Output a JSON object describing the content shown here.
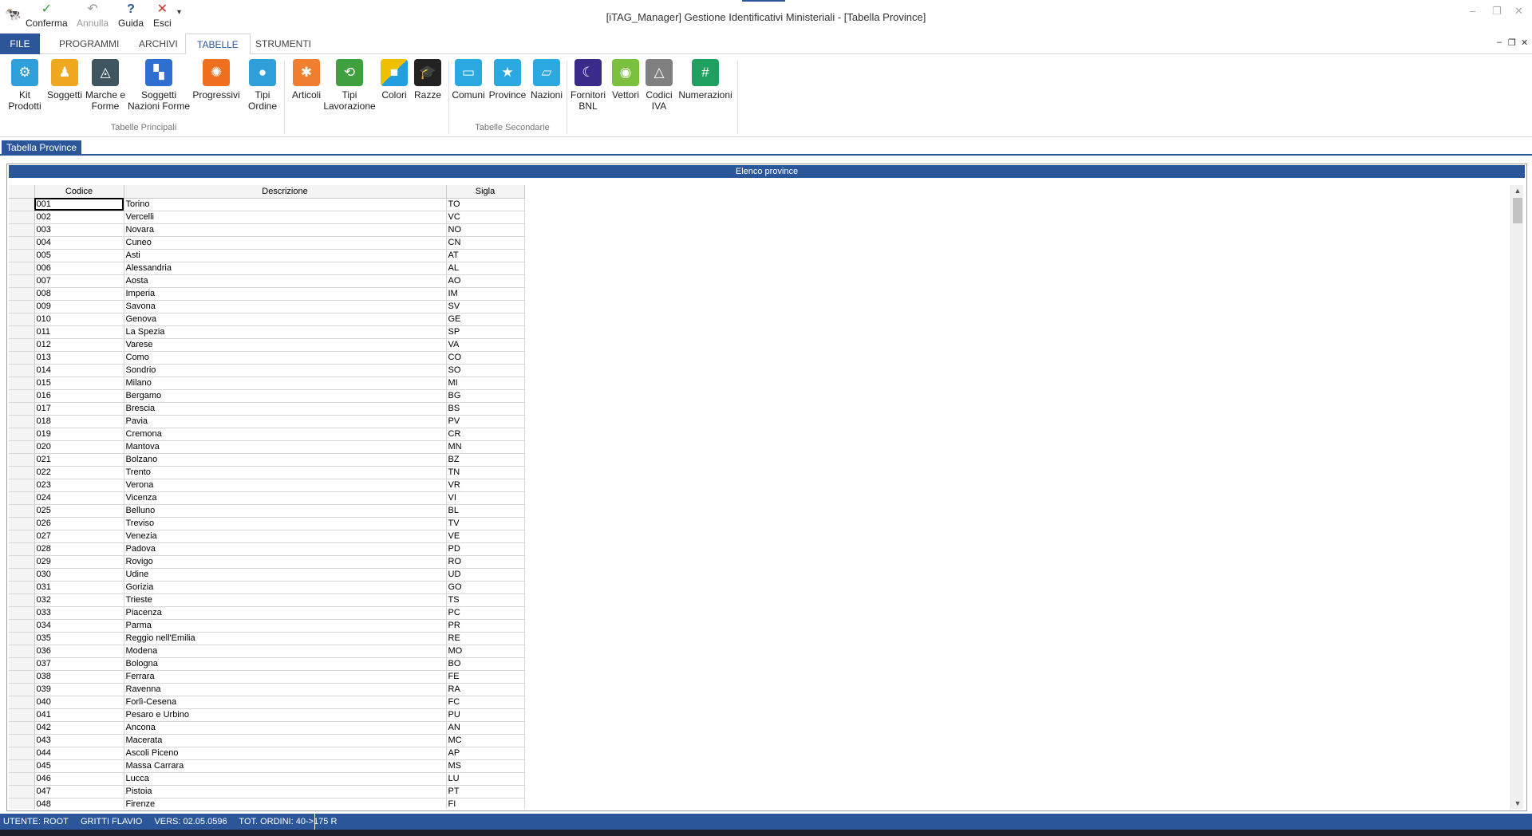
{
  "window": {
    "title": "[iTAG_Manager] Gestione Identificativi Ministeriali - [Tabella Province]"
  },
  "quick_access": {
    "confirm_label": "Conferma",
    "undo_label": "Annulla",
    "help_label": "Guida",
    "exit_label": "Esci"
  },
  "tabs": [
    {
      "label": "FILE"
    },
    {
      "label": "PROGRAMMI"
    },
    {
      "label": "ARCHIVI"
    },
    {
      "label": "TABELLE"
    },
    {
      "label": "STRUMENTI"
    }
  ],
  "ribbon": {
    "group_main": "Tabelle Principali",
    "group_secondary": "Tabelle Secondarie",
    "buttons": [
      {
        "l1": "Kit",
        "l2": "Prodotti",
        "color": "#2e9fd8"
      },
      {
        "l1": "Soggetti",
        "l2": "",
        "color": "#f0a820"
      },
      {
        "l1": "Marche e",
        "l2": "Forme",
        "color": "#3f5560"
      },
      {
        "l1": "Soggetti",
        "l2": "Nazioni Forme",
        "color": "#2e6fd0"
      },
      {
        "l1": "Progressivi",
        "l2": "",
        "color": "#f07020"
      },
      {
        "l1": "Tipi",
        "l2": "Ordine",
        "color": "#2e9fd8"
      },
      {
        "l1": "Articoli",
        "l2": "",
        "color": "#f08030"
      },
      {
        "l1": "Tipi",
        "l2": "Lavorazione",
        "color": "#3fa040"
      },
      {
        "l1": "Colori",
        "l2": "",
        "color": "#f0c000"
      },
      {
        "l1": "Razze",
        "l2": "",
        "color": "#222222"
      },
      {
        "l1": "Comuni",
        "l2": "",
        "color": "#2aa8e0"
      },
      {
        "l1": "Province",
        "l2": "",
        "color": "#2aa8e0"
      },
      {
        "l1": "Nazioni",
        "l2": "",
        "color": "#2aa8e0"
      },
      {
        "l1": "Fornitori",
        "l2": "BNL",
        "color": "#3a2a8a"
      },
      {
        "l1": "Vettori",
        "l2": "",
        "color": "#7cc040"
      },
      {
        "l1": "Codici",
        "l2": "IVA",
        "color": "#808080"
      },
      {
        "l1": "Numerazioni",
        "l2": "",
        "color": "#20a060"
      }
    ]
  },
  "document_tab": "Tabella Province",
  "panel": {
    "header": "Elenco province",
    "columns": [
      "Codice",
      "Descrizione",
      "Sigla"
    ],
    "rows": [
      [
        "001",
        "Torino",
        "TO"
      ],
      [
        "002",
        "Vercelli",
        "VC"
      ],
      [
        "003",
        "Novara",
        "NO"
      ],
      [
        "004",
        "Cuneo",
        "CN"
      ],
      [
        "005",
        "Asti",
        "AT"
      ],
      [
        "006",
        "Alessandria",
        "AL"
      ],
      [
        "007",
        "Aosta",
        "AO"
      ],
      [
        "008",
        "Imperia",
        "IM"
      ],
      [
        "009",
        "Savona",
        "SV"
      ],
      [
        "010",
        "Genova",
        "GE"
      ],
      [
        "011",
        "La Spezia",
        "SP"
      ],
      [
        "012",
        "Varese",
        "VA"
      ],
      [
        "013",
        "Como",
        "CO"
      ],
      [
        "014",
        "Sondrio",
        "SO"
      ],
      [
        "015",
        "Milano",
        "MI"
      ],
      [
        "016",
        "Bergamo",
        "BG"
      ],
      [
        "017",
        "Brescia",
        "BS"
      ],
      [
        "018",
        "Pavia",
        "PV"
      ],
      [
        "019",
        "Cremona",
        "CR"
      ],
      [
        "020",
        "Mantova",
        "MN"
      ],
      [
        "021",
        "Bolzano",
        "BZ"
      ],
      [
        "022",
        "Trento",
        "TN"
      ],
      [
        "023",
        "Verona",
        "VR"
      ],
      [
        "024",
        "Vicenza",
        "VI"
      ],
      [
        "025",
        "Belluno",
        "BL"
      ],
      [
        "026",
        "Treviso",
        "TV"
      ],
      [
        "027",
        "Venezia",
        "VE"
      ],
      [
        "028",
        "Padova",
        "PD"
      ],
      [
        "029",
        "Rovigo",
        "RO"
      ],
      [
        "030",
        "Udine",
        "UD"
      ],
      [
        "031",
        "Gorizia",
        "GO"
      ],
      [
        "032",
        "Trieste",
        "TS"
      ],
      [
        "033",
        "Piacenza",
        "PC"
      ],
      [
        "034",
        "Parma",
        "PR"
      ],
      [
        "035",
        "Reggio nell'Emilia",
        "RE"
      ],
      [
        "036",
        "Modena",
        "MO"
      ],
      [
        "037",
        "Bologna",
        "BO"
      ],
      [
        "038",
        "Ferrara",
        "FE"
      ],
      [
        "039",
        "Ravenna",
        "RA"
      ],
      [
        "040",
        "Forlì-Cesena",
        "FC"
      ],
      [
        "041",
        "Pesaro e Urbino",
        "PU"
      ],
      [
        "042",
        "Ancona",
        "AN"
      ],
      [
        "043",
        "Macerata",
        "MC"
      ],
      [
        "044",
        "Ascoli Piceno",
        "AP"
      ],
      [
        "045",
        "Massa Carrara",
        "MS"
      ],
      [
        "046",
        "Lucca",
        "LU"
      ],
      [
        "047",
        "Pistoia",
        "PT"
      ],
      [
        "048",
        "Firenze",
        "FI"
      ]
    ]
  },
  "status": {
    "user": "UTENTE: ROOT",
    "name": "GRITTI FLAVIO",
    "version": "VERS: 02.05.0596",
    "orders": "TOT. ORDINI: 40->175 R"
  }
}
